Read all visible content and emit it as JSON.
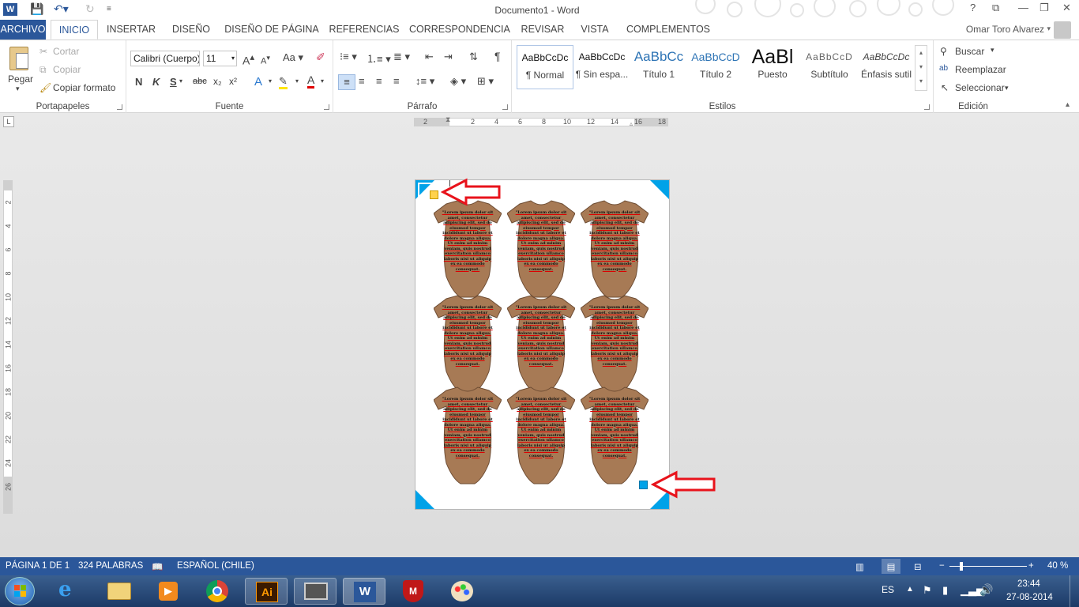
{
  "titlebar": {
    "app_icon": "W",
    "title": "Documento1 - Word",
    "icons": [
      "save-icon",
      "undo-icon",
      "redo-icon",
      "customize-icon",
      "help-icon",
      "restore-ribbon-icon",
      "minimize-icon",
      "maximize-icon",
      "close-icon"
    ]
  },
  "tabs": [
    {
      "label": "ARCHIVO"
    },
    {
      "label": "INICIO"
    },
    {
      "label": "INSERTAR"
    },
    {
      "label": "DISEÑO"
    },
    {
      "label": "DISEÑO DE PÁGINA"
    },
    {
      "label": "REFERENCIAS"
    },
    {
      "label": "CORRESPONDENCIA"
    },
    {
      "label": "REVISAR"
    },
    {
      "label": "VISTA"
    },
    {
      "label": "COMPLEMENTOS"
    }
  ],
  "user": {
    "name": "Omar Toro Alvarez"
  },
  "ribbon": {
    "portapapeles": {
      "label": "Portapapeles",
      "paste": "Pegar",
      "cut": "Cortar",
      "copy": "Copiar",
      "format_painter": "Copiar formato"
    },
    "fuente": {
      "label": "Fuente",
      "font_name": "Calibri (Cuerpo)",
      "font_size": "11",
      "bold": "N",
      "italic": "K",
      "underline": "S",
      "strike": "abc",
      "subscript": "x₂",
      "superscript": "x²",
      "grow": "A",
      "shrink": "A",
      "case": "Aa",
      "text_effects": "A",
      "font_color": "A"
    },
    "parrafo": {
      "label": "Párrafo",
      "pilcrow": "¶"
    },
    "estilos": {
      "label": "Estilos",
      "items": [
        {
          "preview": "AaBbCcDc",
          "name": "¶ Normal"
        },
        {
          "preview": "AaBbCcDc",
          "name": "¶ Sin espa..."
        },
        {
          "preview": "AaBbCc",
          "name": "Título 1"
        },
        {
          "preview": "AaBbCcD",
          "name": "Título 2"
        },
        {
          "preview": "AaBl",
          "name": "Puesto"
        },
        {
          "preview": "AaBbCcD",
          "name": "Subtítulo"
        },
        {
          "preview": "AaBbCcDc",
          "name": "Énfasis sutil"
        }
      ]
    },
    "edicion": {
      "label": "Edición",
      "find": "Buscar",
      "replace": "Reemplazar",
      "select": "Seleccionar"
    }
  },
  "hruler": [
    "2",
    "2",
    "4",
    "6",
    "8",
    "10",
    "12",
    "14",
    "16",
    "18"
  ],
  "vruler": [
    "2",
    "4",
    "6",
    "8",
    "10",
    "12",
    "14",
    "16",
    "18",
    "20",
    "22",
    "24",
    "26"
  ],
  "document": {
    "onesie_text": "\"Lorem ipsum dolor sit amet, consectetur adipiscing elit, sed do eiusmod tempor incididunt ut labore et dolore magna aliqua. Ut enim ad minim veniam, quis nostrud exercitation ullamco laboris nisi ut aliquip ex ea commodo consequat.",
    "colors": {
      "onesie": "#a77a55",
      "corner": "#00a2e8",
      "marker_top": "#ffd24d",
      "marker_bottom": "#00a2e8",
      "arrow": "#e8131b"
    }
  },
  "status": {
    "page": "PÁGINA 1 DE 1",
    "words": "324 PALABRAS",
    "language": "ESPAÑOL (CHILE)",
    "zoom": "40 %"
  },
  "taskbar": {
    "lang": "ES",
    "time": "23:44",
    "date": "27-08-2014"
  }
}
